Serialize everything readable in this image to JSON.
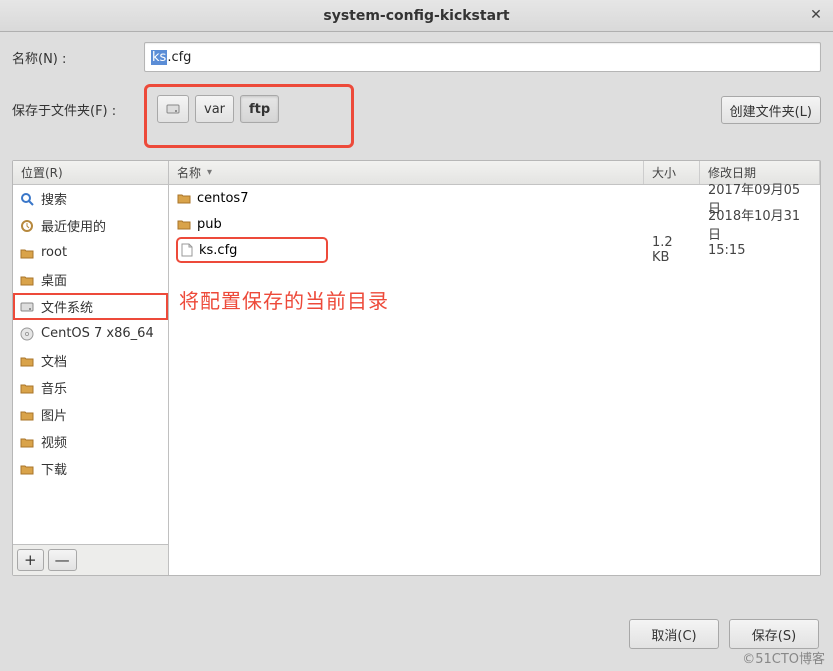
{
  "window": {
    "title": "system-config-kickstart"
  },
  "labels": {
    "name": "名称(N) :",
    "folder": "保存于文件夹(F) :",
    "places": "位置(R)",
    "col_name": "名称",
    "col_size": "大小",
    "col_date": "修改日期",
    "create_folder": "创建文件夹(L)",
    "cancel": "取消(C)",
    "save": "保存(S)"
  },
  "filename": {
    "selected": "ks",
    "rest": ".cfg"
  },
  "path": {
    "segments": [
      {
        "label": "",
        "icon": "disk",
        "active": false
      },
      {
        "label": "var",
        "active": false
      },
      {
        "label": "ftp",
        "active": true
      }
    ]
  },
  "places_items": [
    {
      "label": "搜索",
      "icon": "search"
    },
    {
      "label": "最近使用的",
      "icon": "recent"
    },
    {
      "label": "root",
      "icon": "folder"
    },
    {
      "label": "桌面",
      "icon": "folder"
    },
    {
      "label": "文件系统",
      "icon": "disk",
      "selected": true
    },
    {
      "label": "CentOS 7 x86_64",
      "icon": "cd"
    },
    {
      "label": "文档",
      "icon": "folder"
    },
    {
      "label": "音乐",
      "icon": "folder"
    },
    {
      "label": "图片",
      "icon": "folder"
    },
    {
      "label": "视频",
      "icon": "folder"
    },
    {
      "label": "下载",
      "icon": "folder"
    }
  ],
  "files": [
    {
      "name": "centos7",
      "type": "folder",
      "size": "",
      "date": "2017年09月05日"
    },
    {
      "name": "pub",
      "type": "folder",
      "size": "",
      "date": "2018年10月31日"
    },
    {
      "name": "ks.cfg",
      "type": "file",
      "size": "1.2 KB",
      "date": "15:15",
      "highlight": true
    }
  ],
  "annotation": "将配置保存的当前目录",
  "watermark": "©51CTO博客",
  "icons": {
    "plus": "+",
    "minus": "—",
    "close": "✕"
  }
}
